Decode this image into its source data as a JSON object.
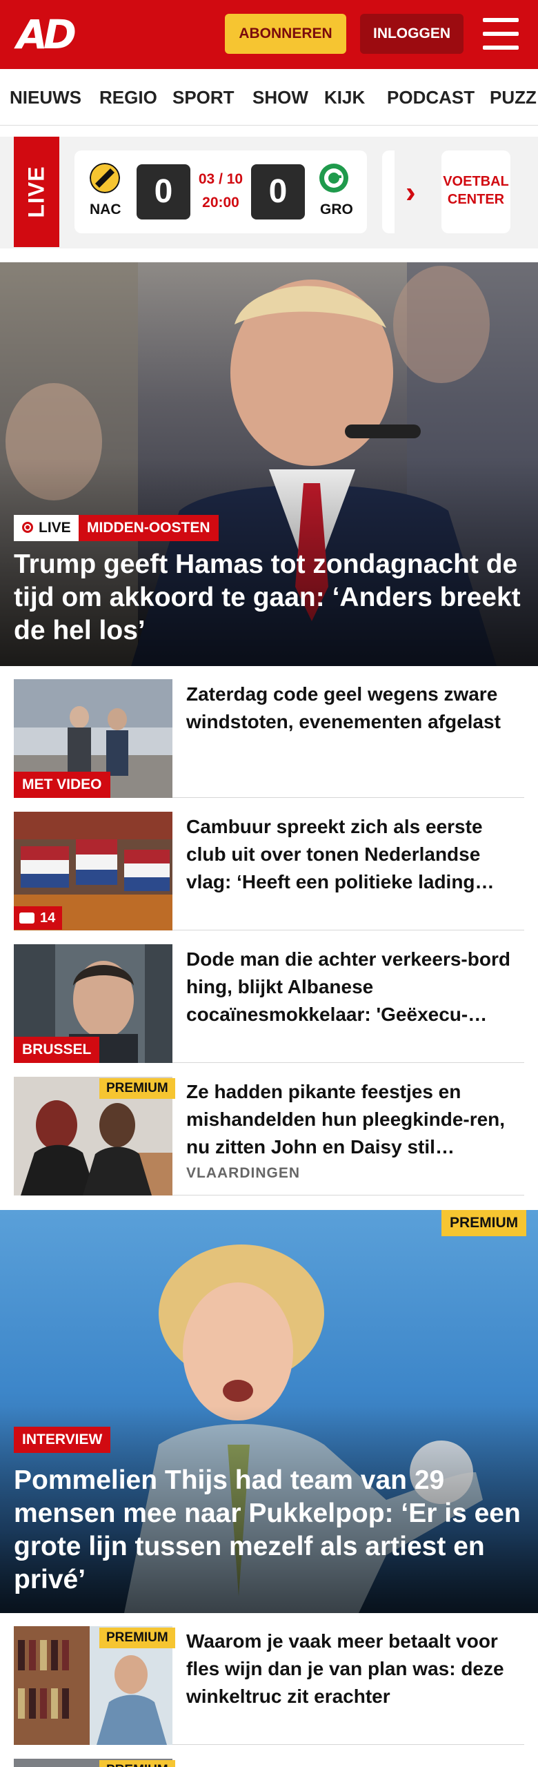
{
  "header": {
    "logo": "AD",
    "subscribe_label": "ABONNEREN",
    "login_label": "INLOGGEN",
    "brand_color": "#d10a11"
  },
  "nav": {
    "items": [
      "NIEUWS",
      "REGIO",
      "SPORT",
      "SHOW",
      "KIJK",
      "PODCAST",
      "PUZZ"
    ]
  },
  "live_bar": {
    "label": "LIVE",
    "match": {
      "home_abbr": "NAC",
      "away_abbr": "GRO",
      "home_score": "0",
      "away_score": "0",
      "date": "03 / 10",
      "time": "20:00"
    },
    "voetbal_center_label": "VOETBAL CENTER"
  },
  "hero1": {
    "live_label": "LIVE",
    "category": "MIDDEN-OOSTEN",
    "title": "Trump geeft Hamas tot zondagnacht de tijd om akkoord te gaan: ‘Anders breekt de hel los’"
  },
  "articles1": [
    {
      "title": "Zaterdag code geel wegens zware windstoten, evenementen afgelast",
      "badge": "MET VIDEO"
    },
    {
      "title": "Cambuur spreekt zich als eerste club uit over tonen Nederlandse vlag: ‘Heeft een politieke lading…",
      "comments": "14"
    },
    {
      "title": "Dode man die achter verkeers-bord hing, blijkt Albanese cocaïnesmokkelaar: 'Geëxecu-…",
      "badge": "BRUSSEL"
    },
    {
      "title": "Ze hadden pikante feestjes en mishandelden hun pleegkinde-ren, nu zitten John en Daisy stil…",
      "premium": "PREMIUM",
      "location": "VLAARDINGEN"
    }
  ],
  "hero2": {
    "premium": "PREMIUM",
    "category": "INTERVIEW",
    "title": "Pommelien Thijs had team van 29 mensen mee naar Pukkelpop: ‘Er is een grote lijn tussen mezelf als artiest en privé’"
  },
  "articles2": [
    {
      "title": "Waarom je vaak meer betaalt voor fles wijn dan je van plan was: deze winkeltruc zit erachter",
      "premium": "PREMIUM"
    },
    {
      "premium": "PREMIUM"
    }
  ]
}
